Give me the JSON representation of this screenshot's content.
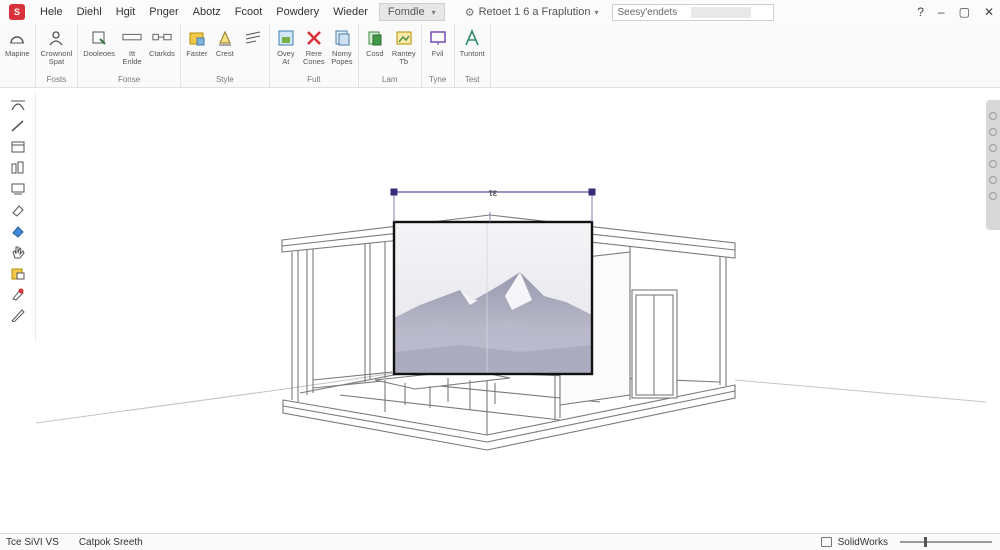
{
  "menubar": {
    "items": [
      "Hele",
      "Diehl",
      "Hgit",
      "Pnger",
      "Abotz",
      "Fcoot",
      "Powdery",
      "Wieder"
    ],
    "active_tab": "Fomdle",
    "doc_title": "Retoet 1 6 a Fraplution",
    "search_placeholder": "Seesy'endets"
  },
  "ribbon": {
    "groups": [
      {
        "name": "",
        "tools": [
          {
            "label": "Mapine",
            "icon": "arc-icon"
          }
        ]
      },
      {
        "name": "Fosts",
        "tools": [
          {
            "label": "Crownonl\nSpat",
            "icon": "person-icon"
          }
        ]
      },
      {
        "name": "Fonse",
        "tools": [
          {
            "label": "Dooleoes",
            "icon": "stack-icon"
          },
          {
            "label": "Itt\nEnlde",
            "icon": "rectangle-icon"
          },
          {
            "label": "Ctarkds",
            "icon": "link-icon"
          }
        ]
      },
      {
        "name": "Style",
        "tools": [
          {
            "label": "Faster",
            "icon": "folder-icon"
          },
          {
            "label": "Crest",
            "icon": "pen-icon"
          },
          {
            "label": "",
            "icon": "lines-icon"
          }
        ]
      },
      {
        "name": "Fult",
        "tools": [
          {
            "label": "Ovey\nAt",
            "icon": "grid-icon"
          },
          {
            "label": "Rere\nCones",
            "icon": "close-icon"
          },
          {
            "label": "Nomy\nPopes",
            "icon": "pages-icon"
          }
        ]
      },
      {
        "name": "Lam",
        "tools": [
          {
            "label": "Cosd",
            "icon": "copy-icon"
          },
          {
            "label": "Rantey\nTb",
            "icon": "image-icon"
          }
        ]
      },
      {
        "name": "Tyne",
        "tools": [
          {
            "label": "Fvil",
            "icon": "screen-icon"
          }
        ]
      },
      {
        "name": "Test",
        "tools": [
          {
            "label": "Tuntont",
            "icon": "text-a-icon"
          }
        ]
      }
    ]
  },
  "canvas": {
    "dimension_label": "τε"
  },
  "statusbar": {
    "left_text": "Tce SiVI VS",
    "sketch_text": "Catpok Sreeth",
    "app_name": "SolidWorks"
  },
  "colors": {
    "accent_red": "#d8333a",
    "sketch_line": "#7a7a7a",
    "selection": "#1a1a1a",
    "dimension": "#3a2a7a"
  }
}
